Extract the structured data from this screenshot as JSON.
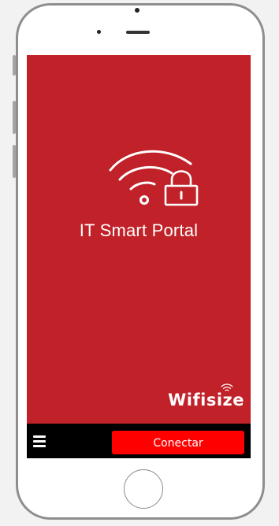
{
  "app": {
    "title": "IT Smart Portal",
    "brand": "Wifisize"
  },
  "toolbar": {
    "menu_icon": "hamburger-menu-icon",
    "connect_label": "Conectar"
  },
  "icons": {
    "logo": "wifi-lock-icon",
    "brand_mark": "wifi-signal-icon"
  },
  "colors": {
    "screen_background": "#c12128",
    "bottom_bar": "#000000",
    "connect_button": "#ff0000",
    "text": "#ffffff"
  }
}
